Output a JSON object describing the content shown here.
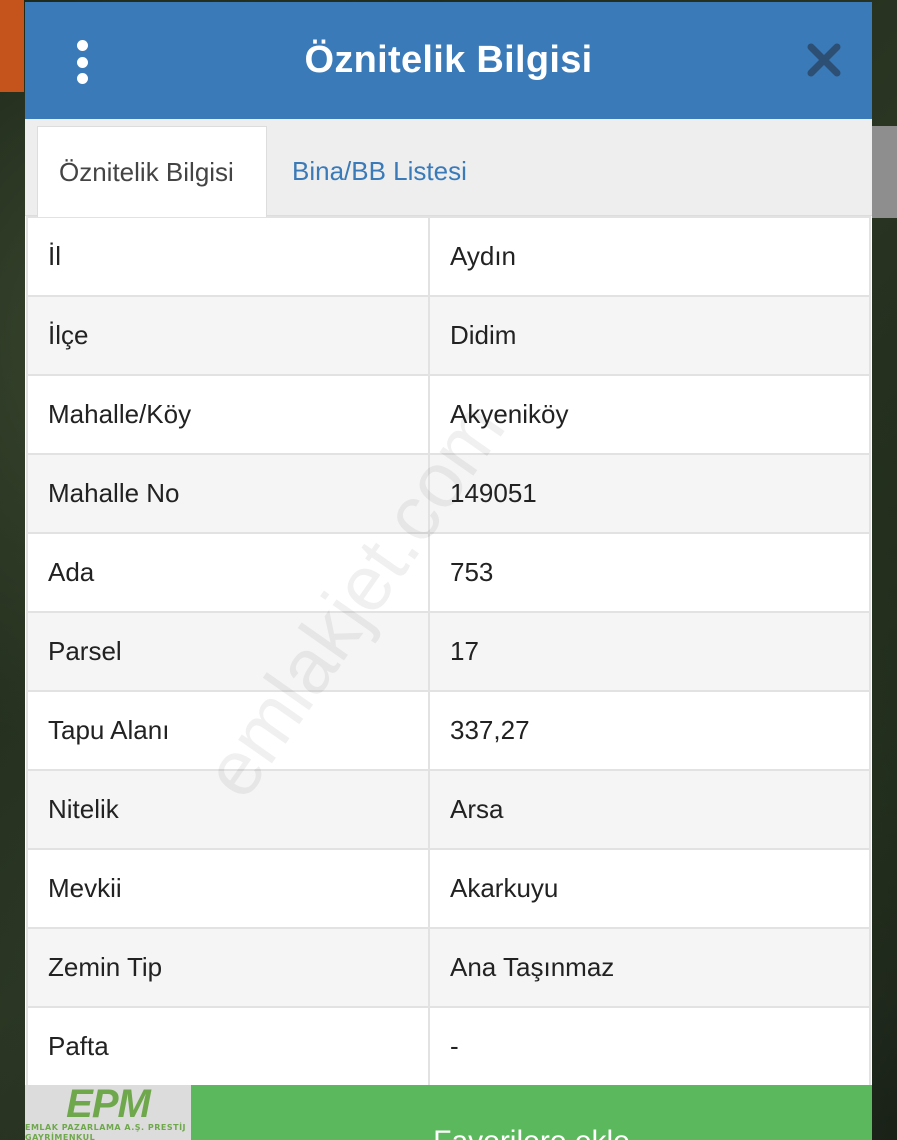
{
  "dialog": {
    "title": "Öznitelik Bilgisi",
    "menu_icon": "kebab-menu-icon",
    "close_icon": "close-icon"
  },
  "tabs": [
    {
      "label": "Öznitelik Bilgisi",
      "active": true
    },
    {
      "label": "Bina/BB Listesi",
      "active": false
    }
  ],
  "attributes": [
    {
      "key": "İl",
      "value": "Aydın"
    },
    {
      "key": "İlçe",
      "value": "Didim"
    },
    {
      "key": "Mahalle/Köy",
      "value": "Akyeniköy"
    },
    {
      "key": "Mahalle No",
      "value": "149051"
    },
    {
      "key": "Ada",
      "value": "753"
    },
    {
      "key": "Parsel",
      "value": "17"
    },
    {
      "key": "Tapu Alanı",
      "value": "337,27"
    },
    {
      "key": "Nitelik",
      "value": "Arsa"
    },
    {
      "key": "Mevkii",
      "value": "Akarkuyu"
    },
    {
      "key": "Zemin Tip",
      "value": "Ana Taşınmaz"
    },
    {
      "key": "Pafta",
      "value": "-"
    }
  ],
  "watermark": "emlakjet.com",
  "logo": {
    "main": "EPM",
    "sub": "EMLAK PAZARLAMA A.Ş. PRESTİJ GAYRİMENKUL"
  },
  "footer": {
    "button_label": "Favorilere ekle"
  },
  "colors": {
    "header": "#3a7ab8",
    "tab_link": "#3a7ab8",
    "footer_button": "#5cb85c",
    "logo_green": "#6fa84c"
  }
}
